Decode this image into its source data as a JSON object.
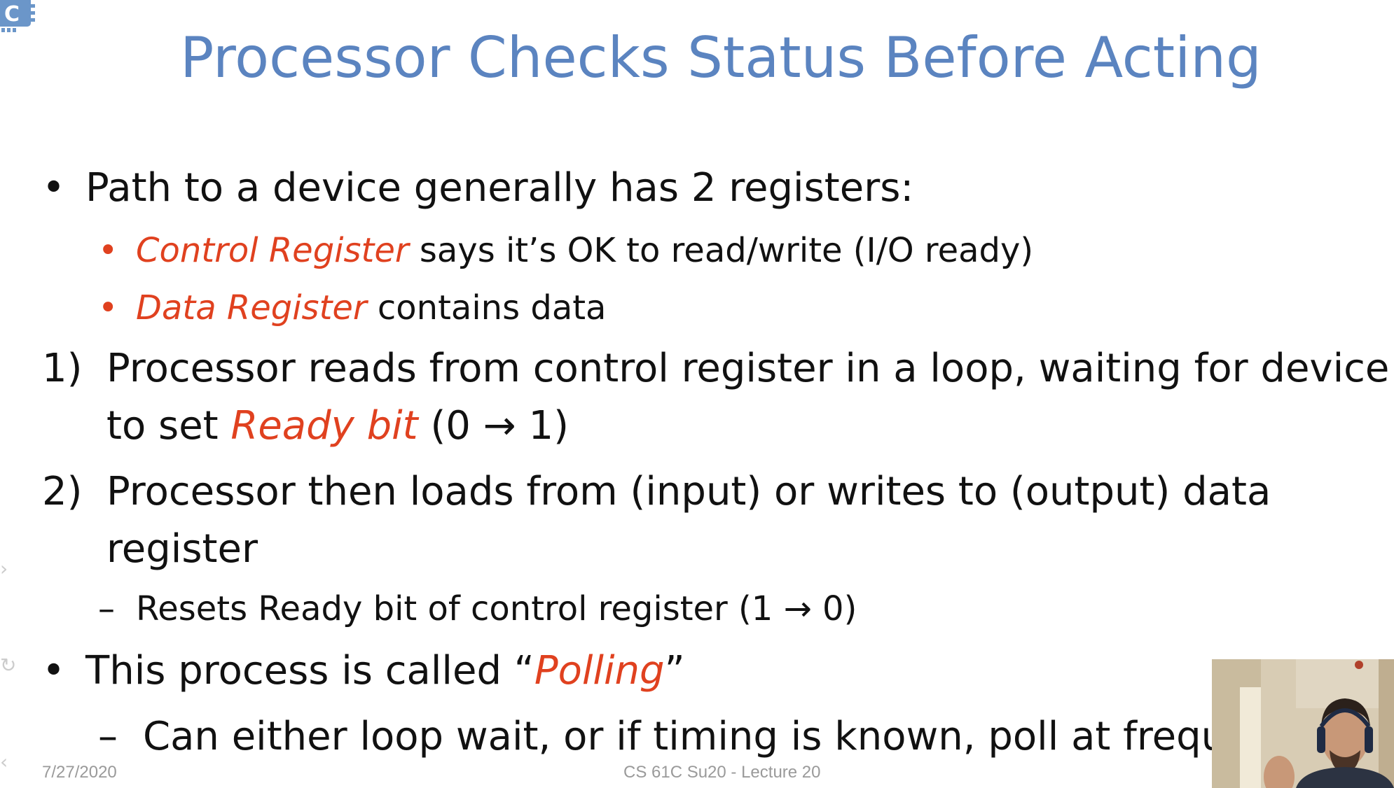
{
  "slide": {
    "title": "Processor Checks Status Before Acting",
    "bullet1": {
      "marker": "•",
      "text": "Path to a device generally has 2 registers:"
    },
    "sub1": {
      "marker": "•",
      "em": "Control Register",
      "rest": " says it’s OK to read/write (I/O ready)"
    },
    "sub2": {
      "marker": "•",
      "em": "Data Register",
      "rest": " contains data"
    },
    "step1": {
      "marker": "1)",
      "line1": "Processor reads from control register in a loop, waiting for device",
      "line2_pre": "to set ",
      "line2_em": "Ready bit",
      "line2_post": " (0 → 1)"
    },
    "step2": {
      "marker": "2)",
      "line1": "Processor then loads from (input) or writes to (output) data",
      "line2": "register"
    },
    "dash1": {
      "marker": "–",
      "text": "Resets Ready bit of control register (1 → 0)"
    },
    "bullet2": {
      "marker": "•",
      "pre": "This process is called “",
      "em": "Polling",
      "post": "”"
    },
    "dash2": {
      "marker": "–",
      "text": "Can either loop wait, or if timing is known, poll at frequency"
    }
  },
  "footer": {
    "date": "7/27/2020",
    "course": "CS 61C Su20 - Lecture 20"
  },
  "colors": {
    "title": "#5b84c0",
    "accent": "#e0411f"
  },
  "icons": {
    "logo": "cs61c-chip-logo",
    "webcam": "presenter-webcam-feed"
  }
}
